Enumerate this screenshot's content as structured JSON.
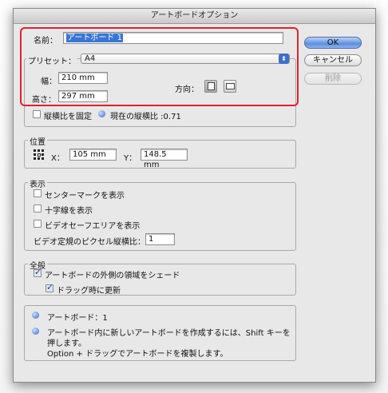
{
  "window": {
    "title": "アートボードオプション"
  },
  "name_field": {
    "label": "名前：",
    "value": "アートボード 1"
  },
  "preset": {
    "label": "プリセット：",
    "selected": "A4"
  },
  "size": {
    "width_label": "幅：",
    "width_value": "210 mm",
    "height_label": "高さ：",
    "height_value": "297 mm",
    "orientation_label": "方向："
  },
  "constrain": {
    "label": "縦横比を固定",
    "checked": false,
    "ratio_text": "現在の縦横比 :0.71"
  },
  "position": {
    "group_label": "位置",
    "x_label": "X：",
    "x_value": "105 mm",
    "y_label": "Y：",
    "y_value": "148.5 mm"
  },
  "display": {
    "group_label": "表示",
    "center_mark": "センターマークを表示",
    "cross_hairs": "十字線を表示",
    "video_safe": "ビデオセーフエリアを表示",
    "pixel_ratio_label": "ビデオ定規のピクセル縦横比：",
    "pixel_ratio_value": "1"
  },
  "global": {
    "group_label": "全般",
    "fade_outside": "アートボードの外側の領域をシェード",
    "update_drag": "ドラッグ時に更新"
  },
  "info": {
    "artboards": "アートボード：1",
    "tip_line1": "アートボード内に新しいアートボードを作成するには、Shift キーを",
    "tip_line2": "押します。",
    "tip_line3": "Option + ドラッグでアートボードを複製します。"
  },
  "buttons": {
    "ok": "OK",
    "cancel": "キャンセル",
    "delete": "削除"
  },
  "colors": {
    "highlight": "#e0202d",
    "accent": "#3875d7"
  }
}
